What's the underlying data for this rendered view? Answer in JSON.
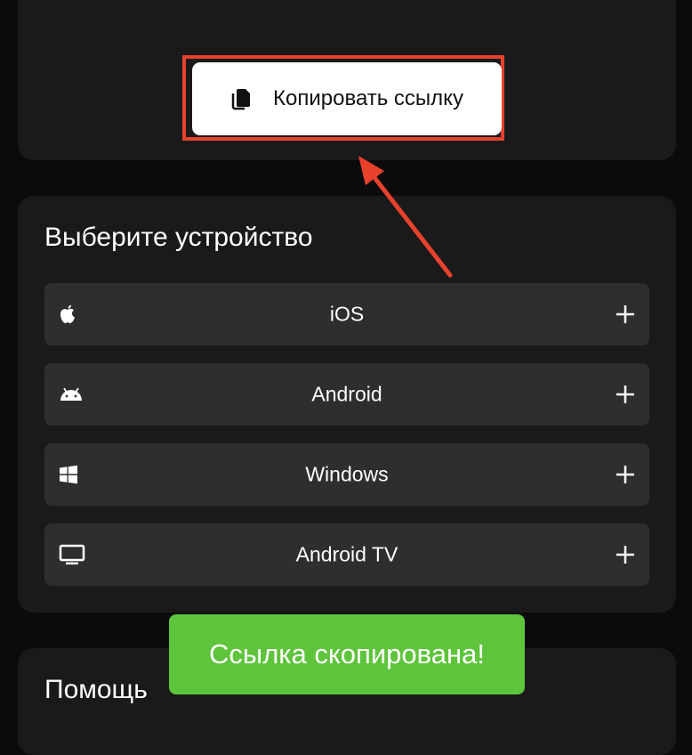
{
  "copy_button": {
    "label": "Копировать ссылку",
    "icon": "copy-icon"
  },
  "devices": {
    "title": "Выберите устройство",
    "items": [
      {
        "label": "iOS",
        "icon": "apple-icon"
      },
      {
        "label": "Android",
        "icon": "android-icon"
      },
      {
        "label": "Windows",
        "icon": "windows-icon"
      },
      {
        "label": "Android TV",
        "icon": "tv-icon"
      }
    ],
    "expand_icon": "plus-icon"
  },
  "help": {
    "title": "Помощь"
  },
  "toast": {
    "text": "Ссылка скопирована!"
  },
  "colors": {
    "background": "#0b0b0b",
    "card": "#1a1a1a",
    "row": "#2e2e2e",
    "highlight": "#e8412c",
    "toast": "#5ec43b"
  }
}
